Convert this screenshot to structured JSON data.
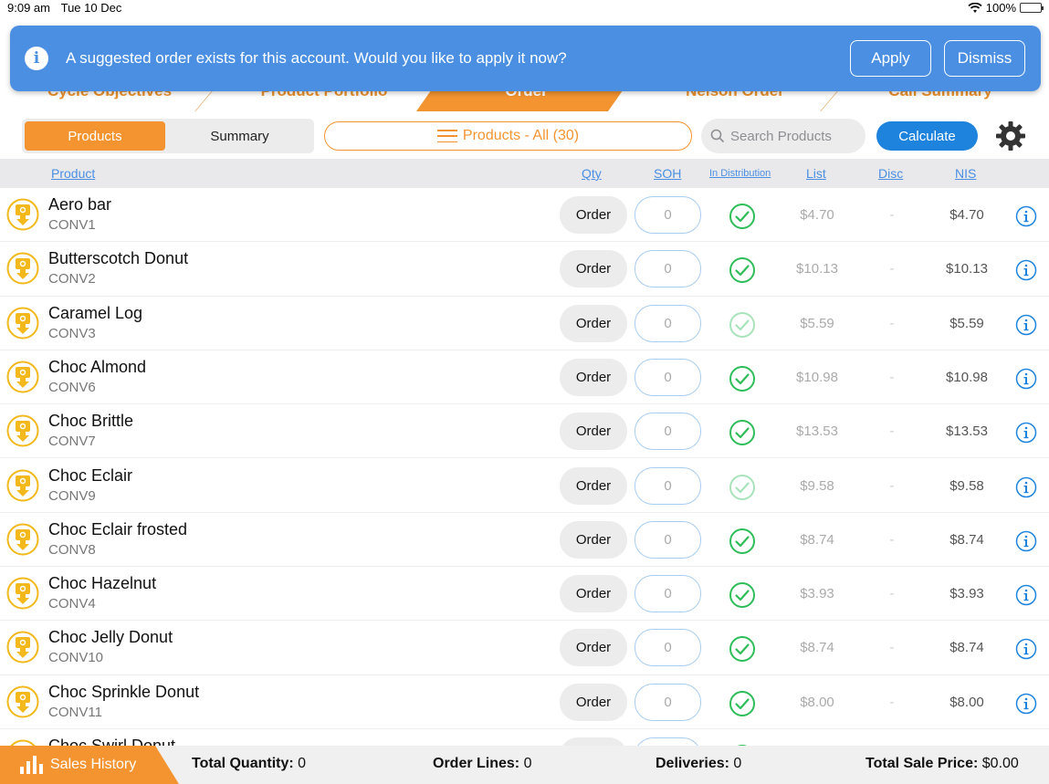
{
  "status_bar": {
    "time": "9:09 am",
    "date": "Tue 10 Dec",
    "battery": "100%"
  },
  "banner": {
    "message": "A suggested order exists for this account. Would you like to apply it now?",
    "apply_label": "Apply",
    "dismiss_label": "Dismiss",
    "color": "#4a8fe2"
  },
  "tabs": [
    {
      "label": "Cycle Objectives"
    },
    {
      "label": "Product Portfolio"
    },
    {
      "label": "Order",
      "active": true
    },
    {
      "label": "Nelson Order"
    },
    {
      "label": "Call Summary"
    }
  ],
  "toolbar": {
    "segment_products": "Products",
    "segment_summary": "Summary",
    "filter_label": "Products - All (30)",
    "search_placeholder": "Search Products",
    "calculate_label": "Calculate"
  },
  "columns": {
    "product": "Product",
    "qty": "Qty",
    "soh": "SOH",
    "in_distribution": "In Distribution",
    "list": "List",
    "disc": "Disc",
    "nis": "NIS"
  },
  "products": [
    {
      "name": "Aero bar",
      "code": "CONV1",
      "order": "Order",
      "qty": "0",
      "in_dist": "strong",
      "list": "$4.70",
      "disc": "-",
      "nis": "$4.70"
    },
    {
      "name": "Butterscotch Donut",
      "code": "CONV2",
      "order": "Order",
      "qty": "0",
      "in_dist": "strong",
      "list": "$10.13",
      "disc": "-",
      "nis": "$10.13"
    },
    {
      "name": "Caramel Log",
      "code": "CONV3",
      "order": "Order",
      "qty": "0",
      "in_dist": "faded",
      "list": "$5.59",
      "disc": "-",
      "nis": "$5.59"
    },
    {
      "name": "Choc Almond",
      "code": "CONV6",
      "order": "Order",
      "qty": "0",
      "in_dist": "strong",
      "list": "$10.98",
      "disc": "-",
      "nis": "$10.98"
    },
    {
      "name": "Choc Brittle",
      "code": "CONV7",
      "order": "Order",
      "qty": "0",
      "in_dist": "strong",
      "list": "$13.53",
      "disc": "-",
      "nis": "$13.53"
    },
    {
      "name": "Choc Eclair",
      "code": "CONV9",
      "order": "Order",
      "qty": "0",
      "in_dist": "faded",
      "list": "$9.58",
      "disc": "-",
      "nis": "$9.58"
    },
    {
      "name": "Choc Eclair frosted",
      "code": "CONV8",
      "order": "Order",
      "qty": "0",
      "in_dist": "strong",
      "list": "$8.74",
      "disc": "-",
      "nis": "$8.74"
    },
    {
      "name": "Choc Hazelnut",
      "code": "CONV4",
      "order": "Order",
      "qty": "0",
      "in_dist": "strong",
      "list": "$3.93",
      "disc": "-",
      "nis": "$3.93"
    },
    {
      "name": "Choc Jelly Donut",
      "code": "CONV10",
      "order": "Order",
      "qty": "0",
      "in_dist": "strong",
      "list": "$8.74",
      "disc": "-",
      "nis": "$8.74"
    },
    {
      "name": "Choc Sprinkle Donut",
      "code": "CONV11",
      "order": "Order",
      "qty": "0",
      "in_dist": "strong",
      "list": "$8.00",
      "disc": "-",
      "nis": "$8.00"
    },
    {
      "name": "Choc Swirl Donut",
      "code": "",
      "order": "",
      "qty": "",
      "in_dist": "strong",
      "list": "",
      "disc": "",
      "nis": ""
    }
  ],
  "footer": {
    "sales_history_label": "Sales History",
    "total_quantity_label": "Total Quantity:",
    "total_quantity": "0",
    "order_lines_label": "Order Lines:",
    "order_lines": "0",
    "deliveries_label": "Deliveries:",
    "deliveries": "0",
    "total_sale_price_label": "Total Sale Price:",
    "total_sale_price": "$0.00"
  },
  "colors": {
    "accent": "#f39430",
    "primary_blue": "#1d83dd",
    "check_green": "#2ebd59"
  }
}
